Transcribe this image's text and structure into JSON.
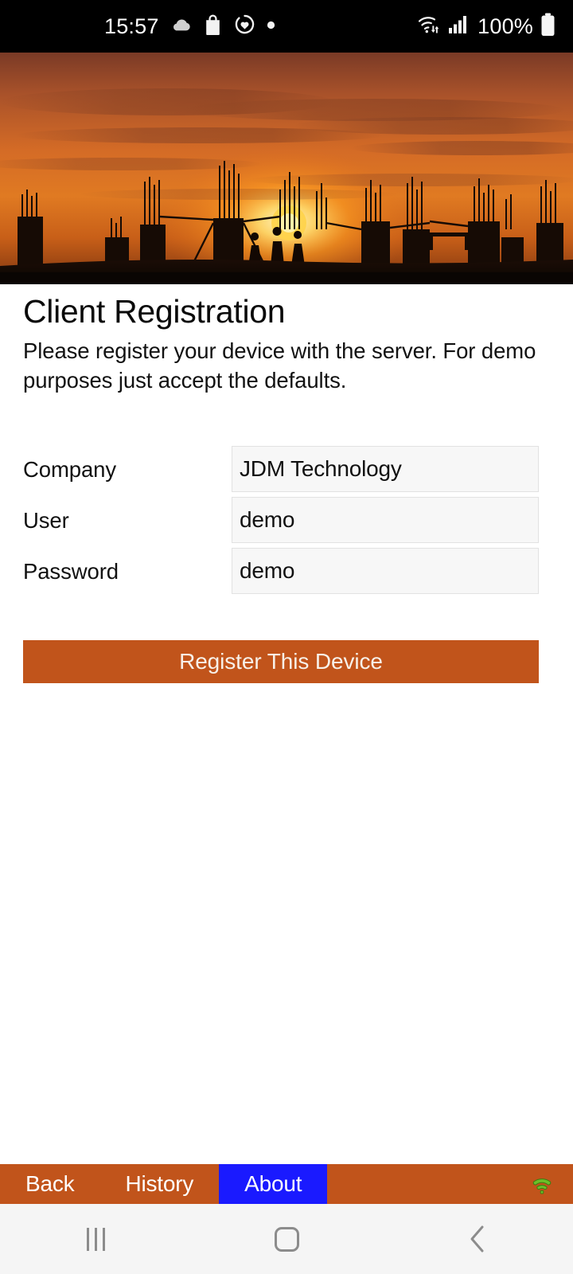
{
  "statusbar": {
    "time": "15:57",
    "battery_percent": "100%",
    "icons_left": [
      "cloud-icon",
      "shopping-bag-icon",
      "heart-circle-icon",
      "dot-icon"
    ],
    "icons_right": [
      "wifi-transfer-icon",
      "cellular-signal-icon",
      "battery-full-icon"
    ]
  },
  "hero": {
    "name": "construction-site-sunset-photo",
    "alt": "Silhouette of construction site columns and rebar against an orange sunset sky"
  },
  "main": {
    "title": "Client Registration",
    "description": "Please register your device with the server. For demo purposes just accept the defaults."
  },
  "form": {
    "fields": [
      {
        "label": "Company",
        "value": "JDM Technology",
        "placeholder": "Company",
        "name": "company"
      },
      {
        "label": "User",
        "value": "demo",
        "placeholder": "User",
        "name": "user"
      },
      {
        "label": "Password",
        "value": "demo",
        "placeholder": "Password",
        "name": "password"
      }
    ],
    "submit_label": "Register This Device"
  },
  "appnav": {
    "items": [
      {
        "label": "Back",
        "active": false
      },
      {
        "label": "History",
        "active": false
      },
      {
        "label": "About",
        "active": true
      }
    ],
    "signal_icon": "wifi-signal-green-icon"
  },
  "sysnav": {
    "recents": "recents-icon",
    "home": "home-icon",
    "back": "back-icon"
  },
  "colors": {
    "accent_orange": "#c1541b",
    "active_blue": "#1a1aff",
    "field_bg": "#f7f7f7",
    "status_bg": "#000000",
    "signal_green": "#5aa81e"
  }
}
